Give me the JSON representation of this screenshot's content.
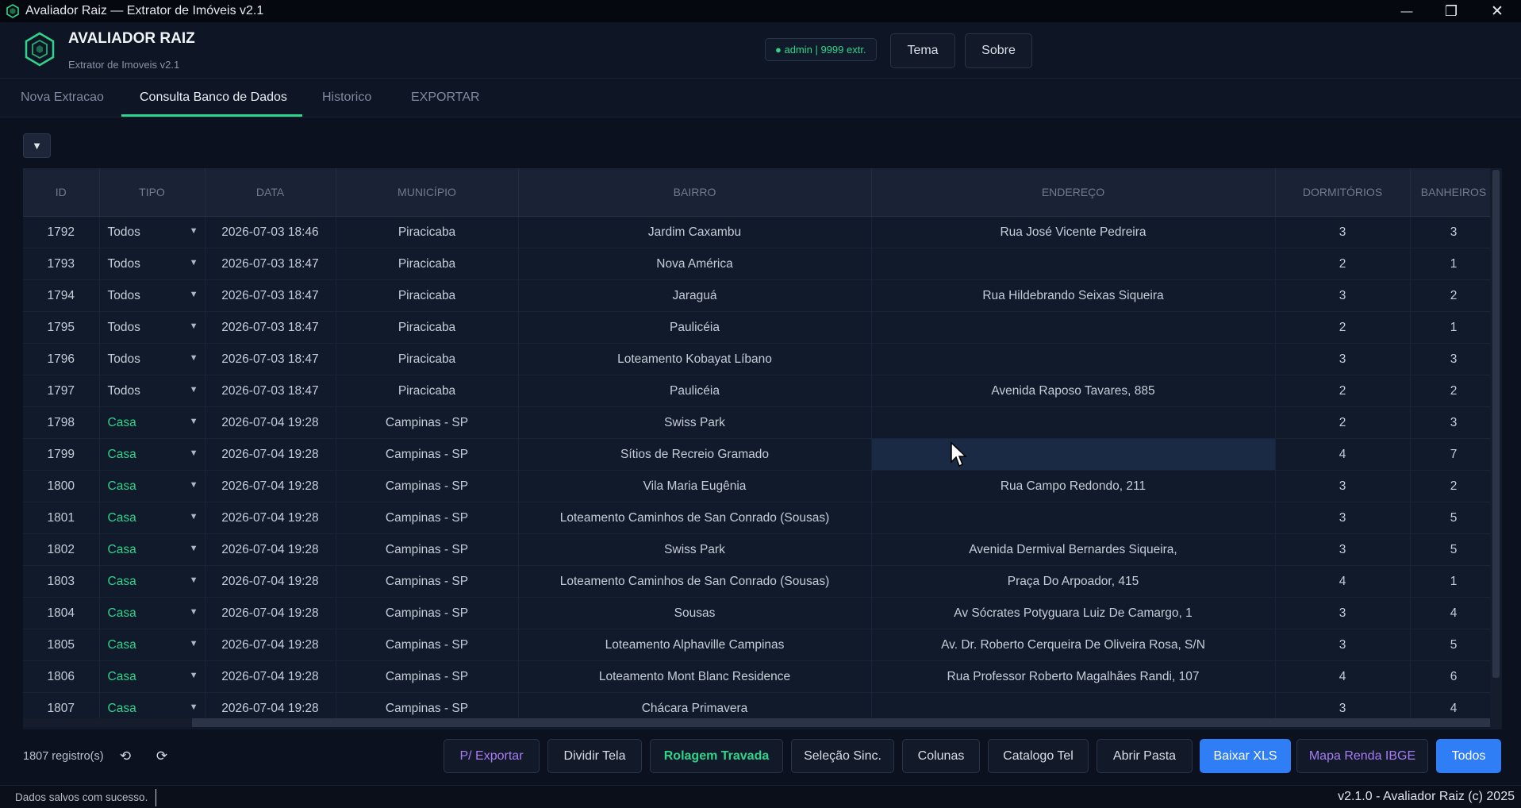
{
  "window": {
    "title": "Avaliador Raiz — Extrator de Imóveis v2.1",
    "minimize": "—",
    "restore": "❐",
    "close": "✕"
  },
  "header": {
    "brand_title": "AVALIADOR RAIZ",
    "brand_subtitle": "Extrator de Imoveis v2.1",
    "user_badge": "● admin | 9999 extr.",
    "theme_button": "Tema",
    "about_button": "Sobre"
  },
  "tabs": [
    {
      "label": "Nova Extracao"
    },
    {
      "label": "Consulta Banco de Dados"
    },
    {
      "label": "Historico"
    },
    {
      "label": "EXPORTAR"
    }
  ],
  "filter_toggle": "▼",
  "table": {
    "columns": [
      "ID",
      "TIPO",
      "DATA",
      "MUNICÍPIO",
      "BAIRRO",
      "ENDEREÇO",
      "DORMITÓRIOS",
      "BANHEIROS"
    ],
    "dropdown_glyph": "▼",
    "rows": [
      [
        "1792",
        "Todos",
        "2026-07-03 18:46",
        "Piracicaba",
        "Jardim Caxambu",
        "Rua José Vicente Pedreira",
        "3",
        "3"
      ],
      [
        "1793",
        "Todos",
        "2026-07-03 18:47",
        "Piracicaba",
        "Nova América",
        "",
        "2",
        "1"
      ],
      [
        "1794",
        "Todos",
        "2026-07-03 18:47",
        "Piracicaba",
        "Jaraguá",
        "Rua Hildebrando Seixas Siqueira",
        "3",
        "2"
      ],
      [
        "1795",
        "Todos",
        "2026-07-03 18:47",
        "Piracicaba",
        "Paulicéia",
        "",
        "2",
        "1"
      ],
      [
        "1796",
        "Todos",
        "2026-07-03 18:47",
        "Piracicaba",
        "Loteamento Kobayat Líbano",
        "",
        "3",
        "3"
      ],
      [
        "1797",
        "Todos",
        "2026-07-03 18:47",
        "Piracicaba",
        "Paulicéia",
        "Avenida Raposo Tavares, 885",
        "2",
        "2"
      ],
      [
        "1798",
        "Casa",
        "2026-07-04 19:28",
        "Campinas - SP",
        "Swiss Park",
        "",
        "2",
        "3"
      ],
      [
        "1799",
        "Casa",
        "2026-07-04 19:28",
        "Campinas - SP",
        "Sítios de Recreio Gramado",
        "",
        "4",
        "7"
      ],
      [
        "1800",
        "Casa",
        "2026-07-04 19:28",
        "Campinas - SP",
        "Vila Maria Eugênia",
        "Rua Campo Redondo, 211",
        "3",
        "2"
      ],
      [
        "1801",
        "Casa",
        "2026-07-04 19:28",
        "Campinas - SP",
        "Loteamento Caminhos de San Conrado (Sousas)",
        "",
        "3",
        "5"
      ],
      [
        "1802",
        "Casa",
        "2026-07-04 19:28",
        "Campinas - SP",
        "Swiss Park",
        "Avenida Dermival Bernardes Siqueira,",
        "3",
        "5"
      ],
      [
        "1803",
        "Casa",
        "2026-07-04 19:28",
        "Campinas - SP",
        "Loteamento Caminhos de San Conrado (Sousas)",
        "Praça Do Arpoador, 415",
        "4",
        "1"
      ],
      [
        "1804",
        "Casa",
        "2026-07-04 19:28",
        "Campinas - SP",
        "Sousas",
        "Av Sócrates Potyguara Luiz De Camargo, 1",
        "3",
        "4"
      ],
      [
        "1805",
        "Casa",
        "2026-07-04 19:28",
        "Campinas - SP",
        "Loteamento Alphaville Campinas",
        "Av. Dr. Roberto Cerqueira De Oliveira Rosa, S/N",
        "3",
        "5"
      ],
      [
        "1806",
        "Casa",
        "2026-07-04 19:28",
        "Campinas - SP",
        "Loteamento Mont Blanc Residence",
        "Rua Professor Roberto Magalhães Randi, 107",
        "4",
        "6"
      ],
      [
        "1807",
        "Casa",
        "2026-07-04 19:28",
        "Campinas - SP",
        "Chácara Primavera",
        "",
        "3",
        "4"
      ]
    ]
  },
  "footer": {
    "record_count": "1807 registro(s)",
    "refresh_icon": "⟲",
    "sync_icon": "⟳",
    "buttons": {
      "export": "P/ Exportar",
      "split": "Dividir Tela",
      "scroll_lock": "Rolagem Travada",
      "sync_select": "Seleção Sinc.",
      "columns": "Colunas",
      "catalog": "Catalogo Tel",
      "open_folder": "Abrir Pasta",
      "download_xls": "Baixar XLS",
      "ibge_map": "Mapa Renda IBGE",
      "all": "Todos"
    }
  },
  "status": {
    "message": "Dados salvos com sucesso.",
    "version": "v2.1.0 - Avaliador Raiz (c) 2025"
  },
  "colors": {
    "accent_green": "#2fd48a",
    "accent_blue": "#2f7ef5",
    "accent_purple": "#a77cf4",
    "background": "#0b111e"
  }
}
